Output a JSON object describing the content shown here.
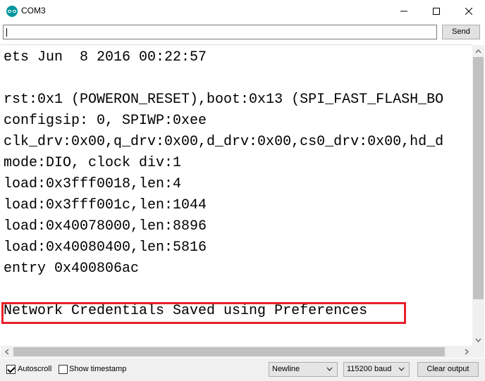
{
  "window": {
    "title": "COM3"
  },
  "send": {
    "input_value": "",
    "button_label": "Send"
  },
  "output": {
    "lines": [
      "ets Jun  8 2016 00:22:57",
      "",
      "rst:0x1 (POWERON_RESET),boot:0x13 (SPI_FAST_FLASH_BO",
      "configsip: 0, SPIWP:0xee",
      "clk_drv:0x00,q_drv:0x00,d_drv:0x00,cs0_drv:0x00,hd_d",
      "mode:DIO, clock div:1",
      "load:0x3fff0018,len:4",
      "load:0x3fff001c,len:1044",
      "load:0x40078000,len:8896",
      "load:0x40080400,len:5816",
      "entry 0x400806ac",
      "",
      "Network Credentials Saved using Preferences"
    ]
  },
  "bottom": {
    "autoscroll": {
      "label": "Autoscroll",
      "checked": true
    },
    "timestamp": {
      "label": "Show timestamp",
      "checked": false
    },
    "line_ending": "Newline",
    "baud": "115200 baud",
    "clear_label": "Clear output"
  },
  "colors": {
    "highlight": "#e8202a",
    "app_icon": "#00979c"
  }
}
